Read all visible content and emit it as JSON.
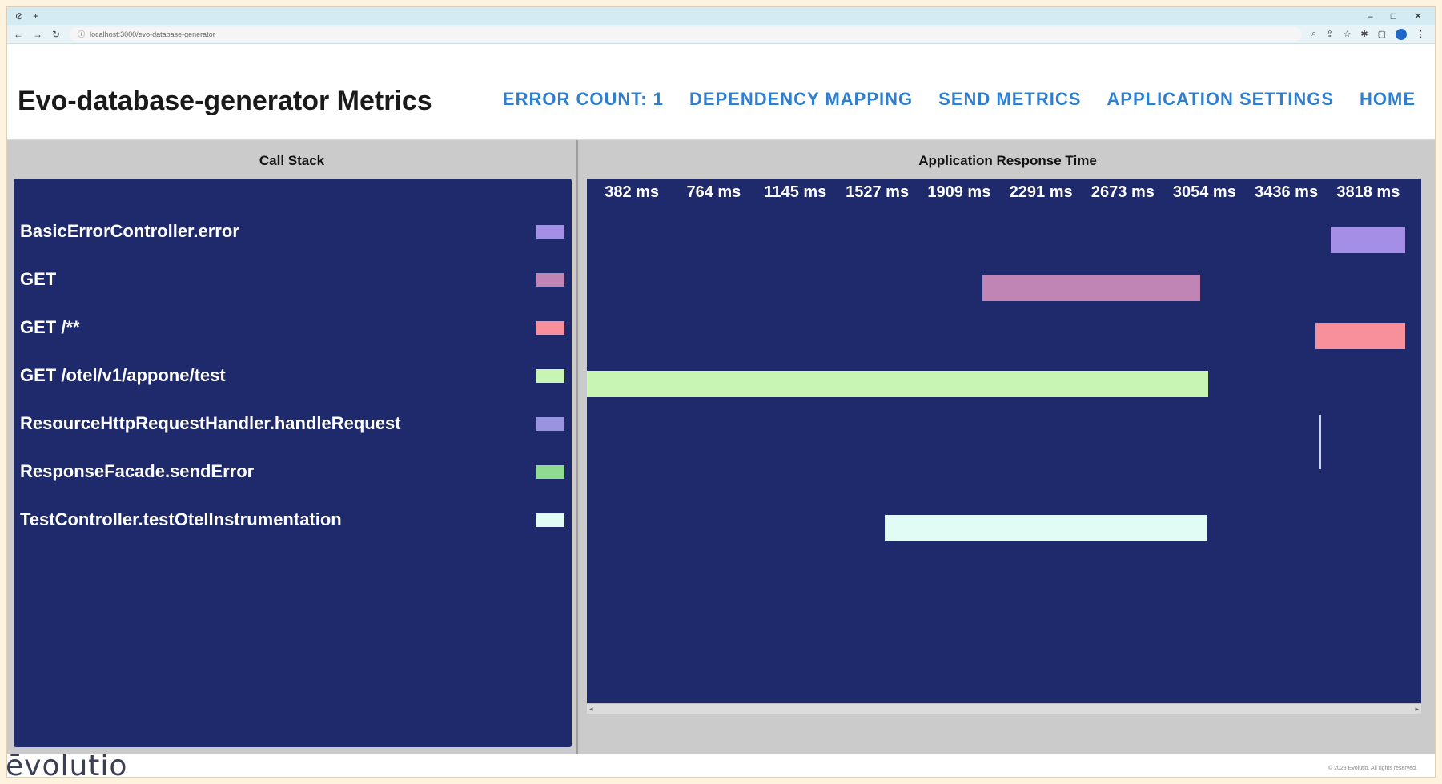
{
  "browser": {
    "tab_icon": "globe-icon",
    "new_tab": "+",
    "url": "localhost:3000/evo-database-generator",
    "window_controls": [
      "–",
      "□",
      "✕"
    ]
  },
  "header": {
    "title": "Evo-database-generator Metrics",
    "nav": [
      {
        "label": "ERROR COUNT: 1"
      },
      {
        "label": "DEPENDENCY MAPPING"
      },
      {
        "label": "SEND METRICS"
      },
      {
        "label": "APPLICATION SETTINGS"
      },
      {
        "label": "HOME"
      }
    ],
    "nav_color": "#2f7fd1"
  },
  "call_stack": {
    "title": "Call Stack",
    "items": [
      {
        "label": "BasicErrorController.error",
        "color": "#a58ee6"
      },
      {
        "label": "GET",
        "color": "#c085b5"
      },
      {
        "label": "GET /**",
        "color": "#f7909b"
      },
      {
        "label": "GET /otel/v1/appone/test",
        "color": "#c8f5b3"
      },
      {
        "label": "ResourceHttpRequestHandler.handleRequest",
        "color": "#9a93e0"
      },
      {
        "label": "ResponseFacade.sendError",
        "color": "#8edc91"
      },
      {
        "label": "TestController.testOtelInstrumentation",
        "color": "#e0fcf4"
      }
    ]
  },
  "response_time": {
    "title": "Application Response Time",
    "ticks": [
      "382 ms",
      "764 ms",
      "1145 ms",
      "1527 ms",
      "1909 ms",
      "2291 ms",
      "2673 ms",
      "3054 ms",
      "3436 ms",
      "3818 ms"
    ],
    "background": "#1e2a6b"
  },
  "chart_data": {
    "type": "gantt",
    "x_unit": "ms",
    "x_ticks": [
      382,
      764,
      1145,
      1527,
      1909,
      2291,
      2673,
      3054,
      3436,
      3818
    ],
    "xlim": [
      0,
      3818
    ],
    "tasks": [
      {
        "name": "BasicErrorController.error",
        "start": 3470,
        "end": 3818
      },
      {
        "name": "GET",
        "start": 1845,
        "end": 2860
      },
      {
        "name": "GET /**",
        "start": 3400,
        "end": 3818
      },
      {
        "name": "GET /otel/v1/appone/test",
        "start": 0,
        "end": 2900
      },
      {
        "name": "ResourceHttpRequestHandler.handleRequest",
        "start": 3418,
        "end": 3424
      },
      {
        "name": "ResponseFacade.sendError",
        "start": 0,
        "end": 0
      },
      {
        "name": "TestController.testOtelInstrumentation",
        "start": 1390,
        "end": 2895
      }
    ]
  },
  "footer": {
    "logo": "ēvolutio",
    "copyright": "© 2023 Evolutio. All rights reserved."
  }
}
